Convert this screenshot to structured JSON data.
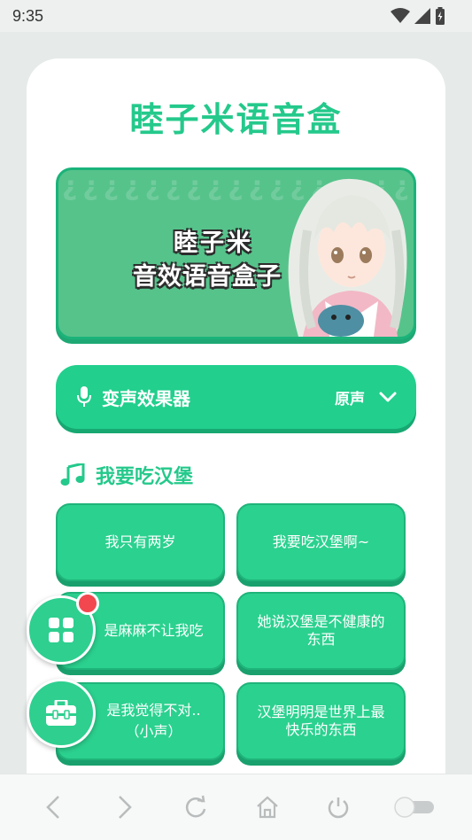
{
  "status_bar": {
    "time": "9:35"
  },
  "app": {
    "title": "睦子米语音盒"
  },
  "banner": {
    "line1": "睦子米",
    "line2": "音效语音盒子",
    "pattern": "¿¿¿¿¿¿¿¿¿¿¿¿¿¿¿¿¿¿¿¿¿¿¿¿¿¿¿¿¿¿¿¿¿¿¿¿¿¿¿¿¿¿¿¿¿¿¿¿¿¿¿¿¿¿¿¿¿¿¿¿¿¿¿¿¿¿¿¿¿¿¿¿"
  },
  "voice_changer": {
    "label": "变声效果器",
    "value": "原声"
  },
  "section": {
    "title": "我要吃汉堡"
  },
  "sounds": [
    {
      "line1": "我只有两岁",
      "line2": ""
    },
    {
      "line1": "我要吃汉堡啊~",
      "line2": ""
    },
    {
      "line1": "是麻麻不让我吃",
      "line2": ""
    },
    {
      "line1": "她说汉堡是不健康的",
      "line2": "东西"
    },
    {
      "line1": "是我觉得不对..",
      "line2": "（小声）"
    },
    {
      "line1": "汉堡明明是世界上最",
      "line2": "快乐的东西"
    }
  ],
  "colors": {
    "accent": "#24c98b",
    "button": "#2bd18f",
    "badge": "#f2474f"
  },
  "icons": [
    "wifi-icon",
    "signal-icon",
    "battery-icon",
    "mic-icon",
    "chevron-down-icon",
    "music-note-icon",
    "grid-icon",
    "toolbox-icon",
    "back-icon",
    "forward-icon",
    "refresh-icon",
    "home-icon",
    "power-icon",
    "toggle-icon"
  ]
}
